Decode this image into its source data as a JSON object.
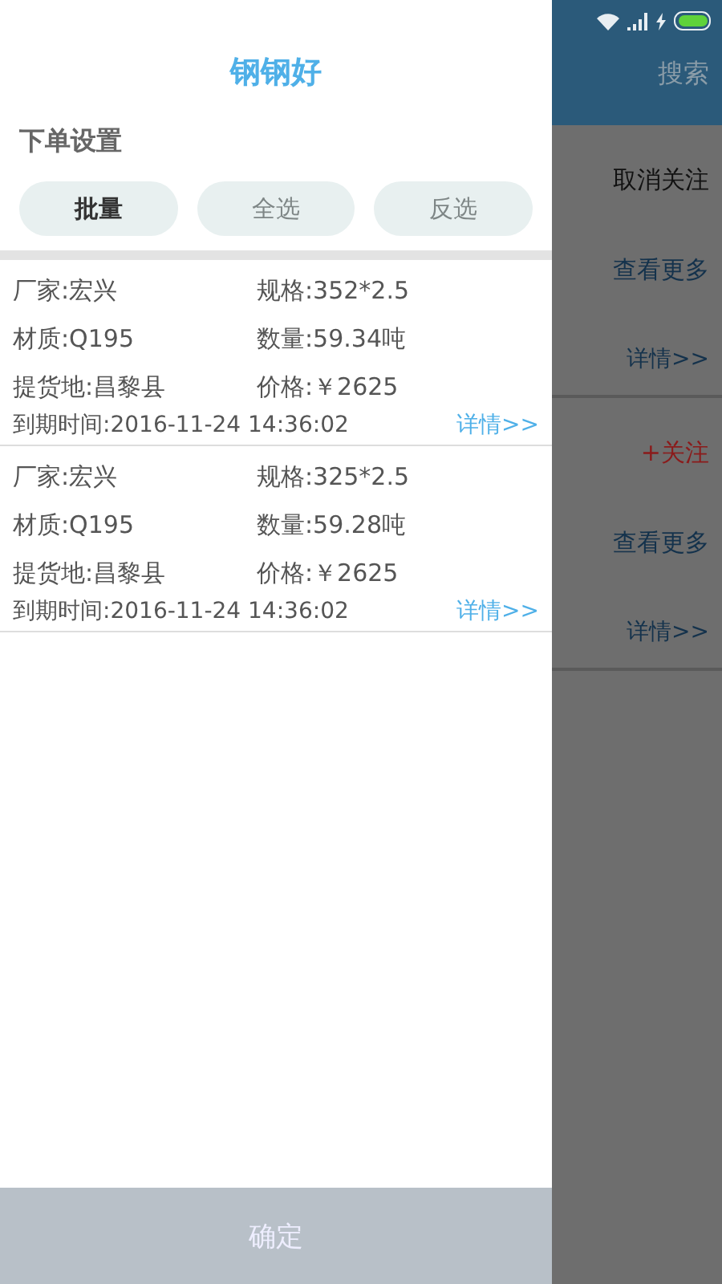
{
  "drawer": {
    "title": "钢钢好",
    "section_title": "下单设置",
    "buttons": [
      {
        "label": "批量",
        "disabled": false
      },
      {
        "label": "全选",
        "disabled": true
      },
      {
        "label": "反选",
        "disabled": true
      }
    ],
    "orders": [
      {
        "manufacturer": "厂家:宏兴",
        "spec": "规格:352*2.5",
        "material": "材质:Q195",
        "quantity": "数量:59.34吨",
        "pickup": "提货地:昌黎县",
        "price": "价格:￥2625",
        "expiry": "到期时间:2016-11-24 14:36:02",
        "details_link": "详情>>"
      },
      {
        "manufacturer": "厂家:宏兴",
        "spec": "规格:325*2.5",
        "material": "材质:Q195",
        "quantity": "数量:59.28吨",
        "pickup": "提货地:昌黎县",
        "price": "价格:￥2625",
        "expiry": "到期时间:2016-11-24 14:36:02",
        "details_link": "详情>>"
      }
    ],
    "confirm_button": "确定"
  },
  "background": {
    "search_button": "搜索",
    "items": [
      {
        "kind": "unfollow",
        "label": "取消关注"
      },
      {
        "kind": "more",
        "label": "查看更多"
      },
      {
        "kind": "details",
        "label": "详情>>"
      },
      {
        "kind": "follow",
        "label": "+关注"
      },
      {
        "kind": "more",
        "label": "查看更多"
      },
      {
        "kind": "details",
        "label": "详情>>"
      }
    ]
  }
}
